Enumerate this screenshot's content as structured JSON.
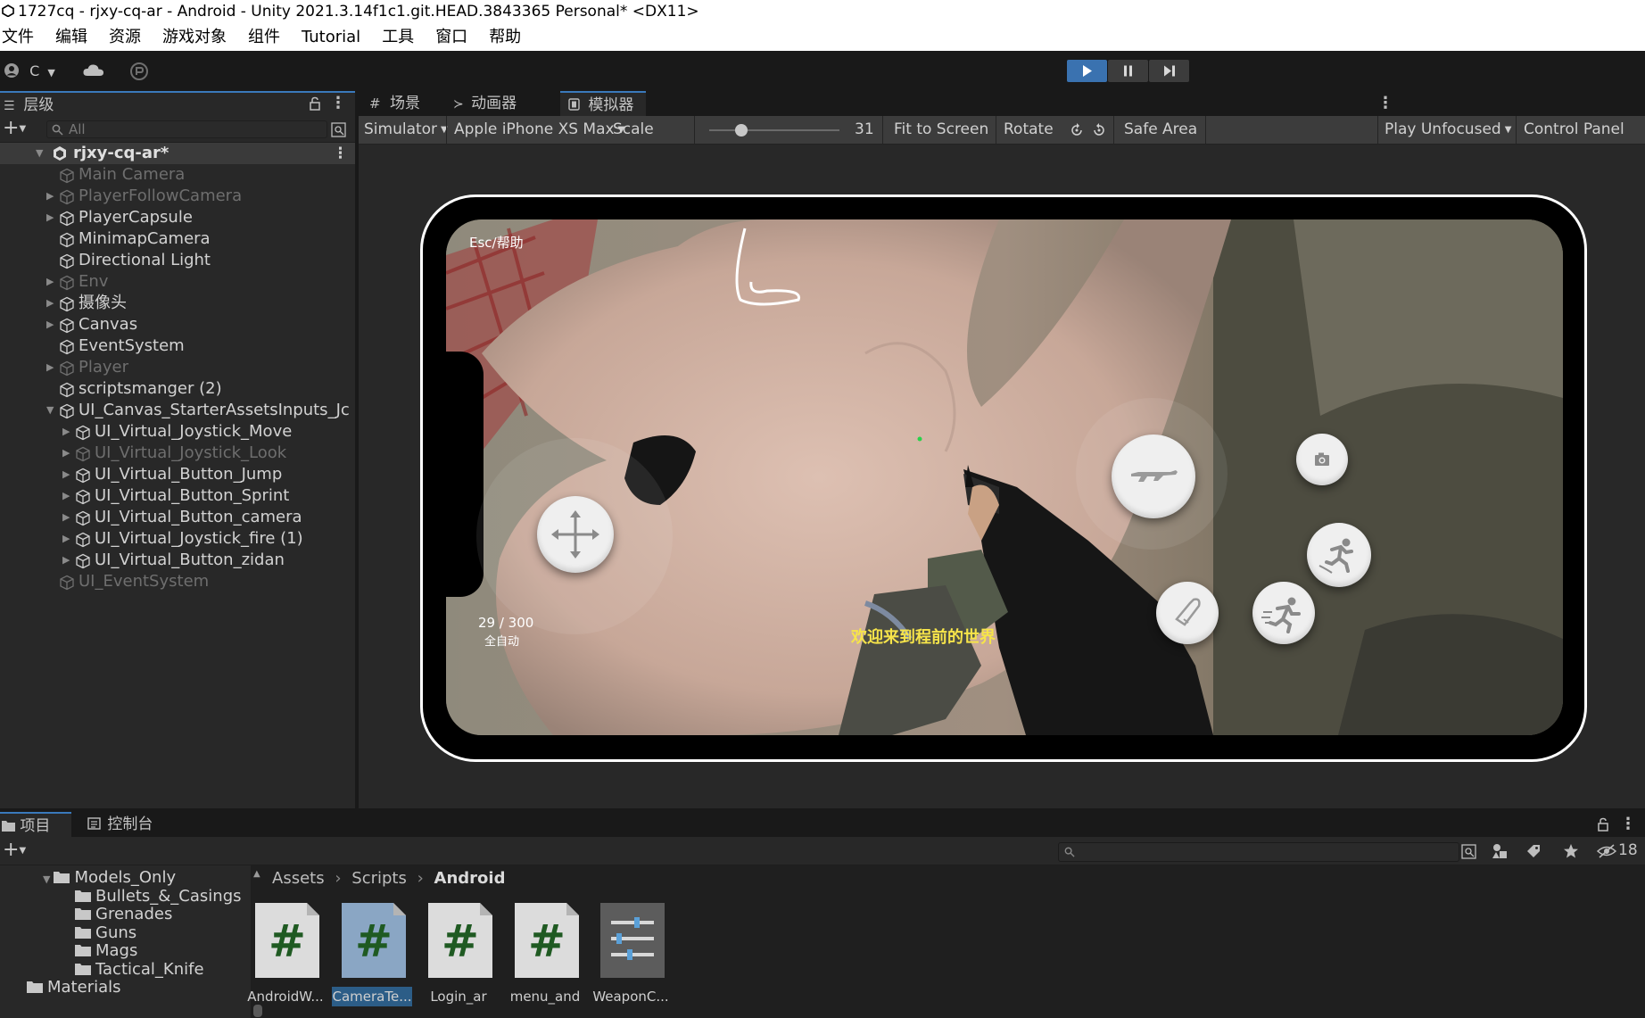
{
  "window": {
    "title": "1727cq - rjxy-cq-ar - Android - Unity 2021.3.14f1c1.git.HEAD.3843365 Personal* <DX11>"
  },
  "menu": [
    "文件",
    "编辑",
    "资源",
    "游戏对象",
    "组件",
    "Tutorial",
    "工具",
    "窗口",
    "帮助"
  ],
  "toolbar": {
    "account_label": "C"
  },
  "hierarchy": {
    "tab_label": "层级",
    "search_placeholder": "All",
    "scene_name": "rjxy-cq-ar*",
    "items": [
      {
        "label": "Main Camera",
        "depth": 1,
        "expandable": false,
        "dim": true
      },
      {
        "label": "PlayerFollowCamera",
        "depth": 1,
        "expandable": true,
        "dim": true
      },
      {
        "label": "PlayerCapsule",
        "depth": 1,
        "expandable": true,
        "dim": false
      },
      {
        "label": "MinimapCamera",
        "depth": 1,
        "expandable": false,
        "dim": false
      },
      {
        "label": "Directional Light",
        "depth": 1,
        "expandable": false,
        "dim": false
      },
      {
        "label": "Env",
        "depth": 1,
        "expandable": true,
        "dim": true
      },
      {
        "label": "摄像头",
        "depth": 1,
        "expandable": true,
        "dim": false
      },
      {
        "label": "Canvas",
        "depth": 1,
        "expandable": true,
        "dim": false
      },
      {
        "label": "EventSystem",
        "depth": 1,
        "expandable": false,
        "dim": false
      },
      {
        "label": "Player",
        "depth": 1,
        "expandable": true,
        "dim": true
      },
      {
        "label": "scriptsmanger (2)",
        "depth": 1,
        "expandable": false,
        "dim": false
      },
      {
        "label": "UI_Canvas_StarterAssetsInputs_Jc",
        "depth": 1,
        "expandable": true,
        "expanded": true,
        "dim": false
      },
      {
        "label": "UI_Virtual_Joystick_Move",
        "depth": 2,
        "expandable": true,
        "dim": false
      },
      {
        "label": "UI_Virtual_Joystick_Look",
        "depth": 2,
        "expandable": true,
        "dim": true
      },
      {
        "label": "UI_Virtual_Button_Jump",
        "depth": 2,
        "expandable": true,
        "dim": false
      },
      {
        "label": "UI_Virtual_Button_Sprint",
        "depth": 2,
        "expandable": true,
        "dim": false
      },
      {
        "label": "UI_Virtual_Button_camera",
        "depth": 2,
        "expandable": true,
        "dim": false
      },
      {
        "label": "UI_Virtual_Joystick_fire (1)",
        "depth": 2,
        "expandable": true,
        "dim": false
      },
      {
        "label": "UI_Virtual_Button_zidan",
        "depth": 2,
        "expandable": true,
        "dim": false
      },
      {
        "label": "UI_EventSystem",
        "depth": 1,
        "expandable": false,
        "dim": true
      }
    ]
  },
  "view_tabs": [
    {
      "label": "场景",
      "icon": "grid-icon"
    },
    {
      "label": "动画器",
      "icon": "animator-icon"
    },
    {
      "label": "模拟器",
      "icon": "simulator-icon",
      "active": true
    }
  ],
  "simulator_toolbar": {
    "mode": "Simulator",
    "device": "Apple iPhone XS Max",
    "scale_label": "Scale",
    "scale_value": "31",
    "fit_label": "Fit to Screen",
    "rotate_label": "Rotate",
    "safe_area_label": "Safe Area",
    "play_mode": "Play Unfocused",
    "control_panel": "Control Panel"
  },
  "game_hud": {
    "help": "Esc/帮助",
    "ammo": "29 / 300",
    "fire_mode": "全自动",
    "welcome": "欢迎来到程前的世界"
  },
  "bottom_tabs": [
    {
      "label": "项目",
      "icon": "folder-icon",
      "active": true
    },
    {
      "label": "控制台",
      "icon": "console-icon"
    }
  ],
  "project": {
    "hidden_count": "18",
    "folders": [
      {
        "label": "Models_Only",
        "depth": 2,
        "open": true
      },
      {
        "label": "Bullets_&_Casings",
        "depth": 3
      },
      {
        "label": "Grenades",
        "depth": 3
      },
      {
        "label": "Guns",
        "depth": 3
      },
      {
        "label": "Mags",
        "depth": 3
      },
      {
        "label": "Tactical_Knife",
        "depth": 3
      },
      {
        "label": "Materials",
        "depth": 1
      }
    ],
    "breadcrumb": [
      "Assets",
      "Scripts",
      "Android"
    ],
    "assets": [
      {
        "name": "AndroidW...",
        "type": "script"
      },
      {
        "name": "CameraTe...",
        "type": "script",
        "selected": true
      },
      {
        "name": "Login_ar",
        "type": "script"
      },
      {
        "name": "menu_and",
        "type": "script"
      },
      {
        "name": "WeaponC...",
        "type": "scriptable-object"
      }
    ]
  }
}
